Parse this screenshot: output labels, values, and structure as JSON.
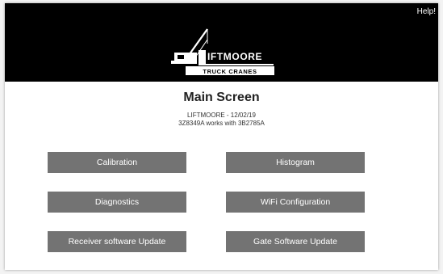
{
  "header": {
    "help_label": "Help!",
    "logo_text": "IFTMOORE",
    "logo_subtext": "TRUCK CRANES",
    "background_color": "#000000"
  },
  "main": {
    "title": "Main Screen",
    "subtitle_line1": "LIFTMOORE - 12/02/19",
    "subtitle_line2": "3Z8349A works with 3B2785A"
  },
  "buttons": {
    "calibration": "Calibration",
    "histogram": "Histogram",
    "diagnostics": "Diagnostics",
    "wifi_configuration": "WiFi Configuration",
    "receiver_update": "Receiver software Update",
    "gate_update": "Gate Software Update",
    "color": "#737373"
  }
}
